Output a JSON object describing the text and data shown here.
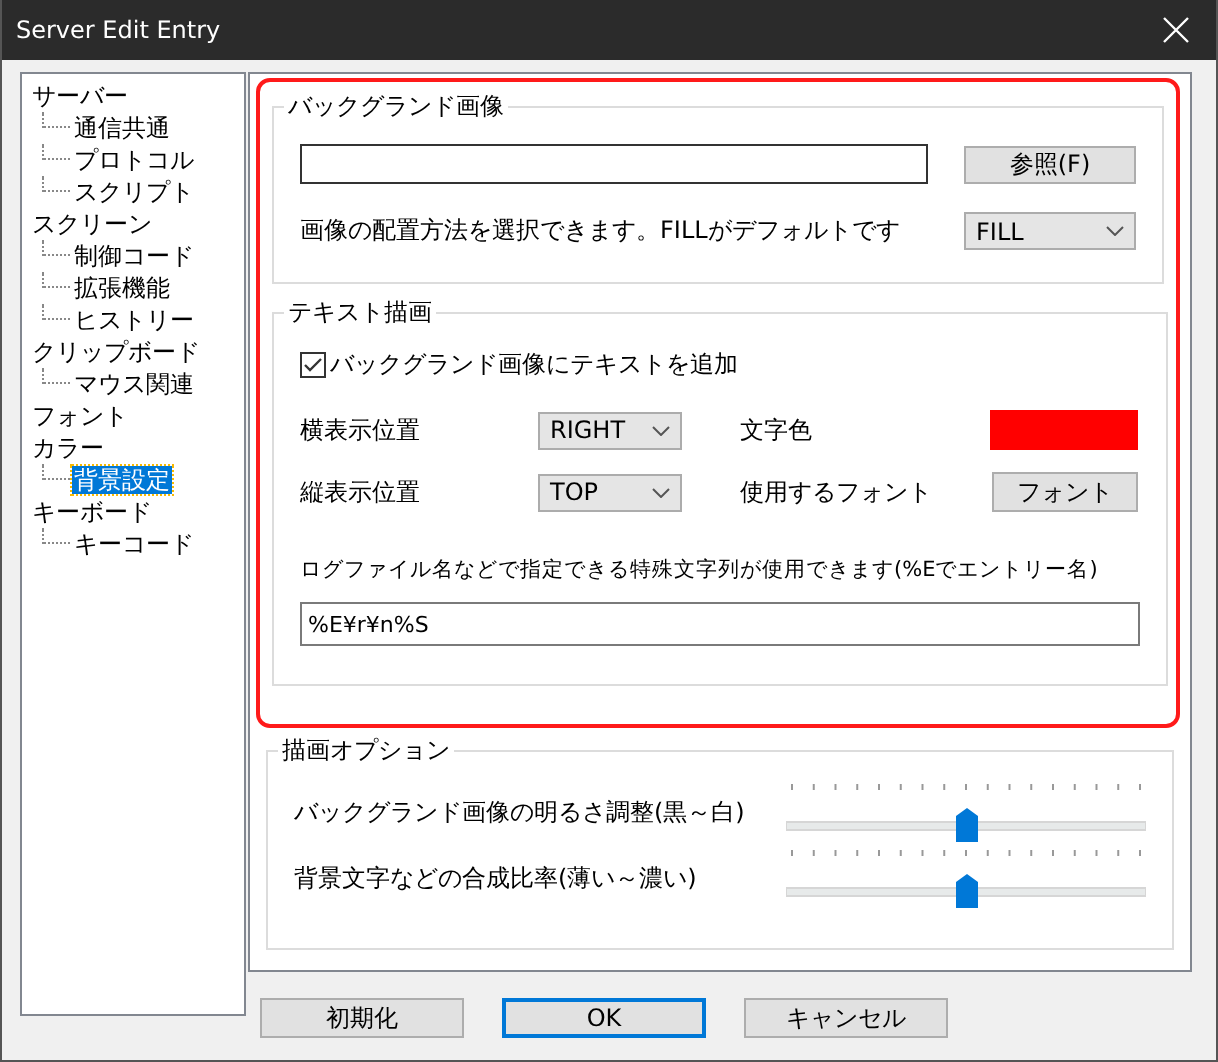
{
  "window": {
    "title": "Server Edit Entry"
  },
  "tree": [
    {
      "label": "サーバー",
      "selected": false,
      "children": [
        {
          "label": "通信共通",
          "selected": false
        },
        {
          "label": "プロトコル",
          "selected": false
        },
        {
          "label": "スクリプト",
          "selected": false
        }
      ]
    },
    {
      "label": "スクリーン",
      "selected": false,
      "children": [
        {
          "label": "制御コード",
          "selected": false
        },
        {
          "label": "拡張機能",
          "selected": false
        },
        {
          "label": "ヒストリー",
          "selected": false
        }
      ]
    },
    {
      "label": "クリップボード",
      "selected": false,
      "children": [
        {
          "label": "マウス関連",
          "selected": false
        }
      ]
    },
    {
      "label": "フォント",
      "selected": false
    },
    {
      "label": "カラー",
      "selected": false,
      "children": [
        {
          "label": "背景設定",
          "selected": true
        }
      ]
    },
    {
      "label": "キーボード",
      "selected": false,
      "children": [
        {
          "label": "キーコード",
          "selected": false
        }
      ]
    }
  ],
  "background_image": {
    "title": "バックグランド画像",
    "browse_button": "参照(F)",
    "placement_label": "画像の配置方法を選択できます。FILLがデフォルトです",
    "placement_select": "FILL"
  },
  "text_drawing": {
    "title": "テキスト描画",
    "checkbox": {
      "label": "バックグランド画像にテキストを追加",
      "checked": true
    },
    "horizontal": {
      "label": "横表示位置",
      "value": "RIGHT"
    },
    "text_color": {
      "label": "文字色",
      "color": "#ff0000"
    },
    "vertical": {
      "label": "縦表示位置",
      "value": "TOP"
    },
    "font": {
      "label": "使用するフォント",
      "button": "フォント"
    },
    "hint": "ログファイル名などで指定できる特殊文字列が使用できます(%Eでエントリー名)",
    "format_field": {
      "value": "%E¥r¥n%S"
    }
  },
  "drawing_options": {
    "title": "描画オプション",
    "sliders": [
      {
        "label": "バックグランド画像の明るさ調整(黒～白)",
        "level": 0.5
      },
      {
        "label": "背景文字などの合成比率(薄い～濃い)",
        "level": 0.5
      }
    ]
  },
  "buttons": [
    {
      "label": "初期化",
      "default": false
    },
    {
      "label": "OK",
      "default": true
    },
    {
      "label": "キャンセル",
      "default": false
    }
  ]
}
